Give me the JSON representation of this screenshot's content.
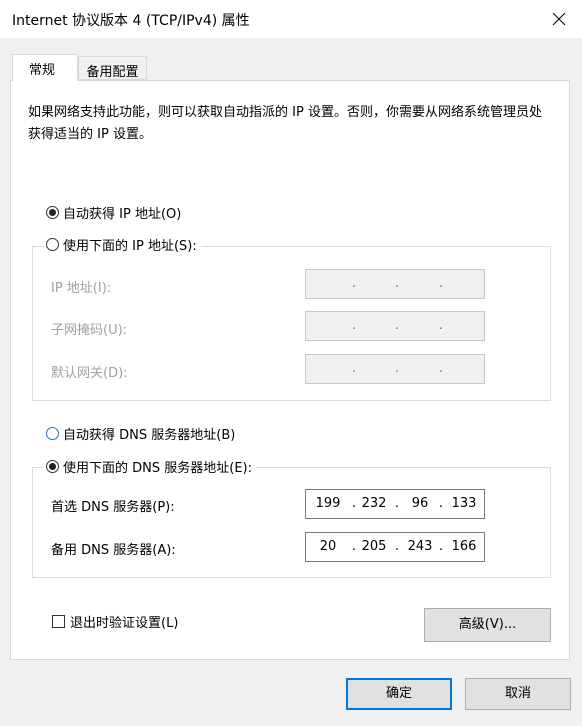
{
  "window": {
    "title": "Internet 协议版本 4 (TCP/IPv4) 属性"
  },
  "tabs": [
    {
      "label": "常规"
    },
    {
      "label": "备用配置"
    }
  ],
  "description": "如果网络支持此功能，则可以获取自动指派的 IP 设置。否则，你需要从网络系统管理员处获得适当的 IP 设置。",
  "ip": {
    "auto_label": "自动获得 IP 地址(O)",
    "manual_label": "使用下面的 IP 地址(S):",
    "mode": "auto",
    "fields": [
      {
        "label": "IP 地址(I):",
        "octets": [
          "",
          "",
          "",
          ""
        ]
      },
      {
        "label": "子网掩码(U):",
        "octets": [
          "",
          "",
          "",
          ""
        ]
      },
      {
        "label": "默认网关(D):",
        "octets": [
          "",
          "",
          "",
          ""
        ]
      }
    ]
  },
  "dns": {
    "auto_label": "自动获得 DNS 服务器地址(B)",
    "manual_label": "使用下面的 DNS 服务器地址(E):",
    "mode": "manual",
    "fields": [
      {
        "label": "首选 DNS 服务器(P):",
        "octets": [
          "199",
          "232",
          "96",
          "133"
        ]
      },
      {
        "label": "备用 DNS 服务器(A):",
        "octets": [
          "20",
          "205",
          "243",
          "166"
        ]
      }
    ]
  },
  "validate_label": "退出时验证设置(L)",
  "advanced_label": "高级(V)...",
  "ok_label": "确定",
  "cancel_label": "取消",
  "icons": {
    "close": "close-icon"
  },
  "colors": {
    "accent": "#0078d7",
    "radio_focus": "#1e6fd8"
  }
}
